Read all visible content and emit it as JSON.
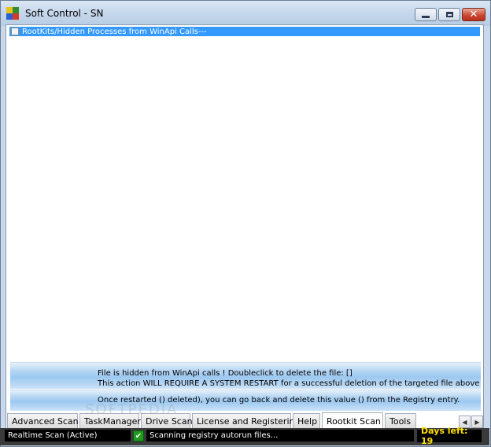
{
  "window": {
    "title": "Soft Control - SN"
  },
  "list": {
    "items": [
      {
        "label": "RootKits/Hidden Processes from WinApi Calls---",
        "selected": true,
        "checked": false
      }
    ]
  },
  "info": {
    "line1": "File is hidden from WinApi calls ! Doubleclick to delete the file: []",
    "line2": "This action WILL REQUIRE A SYSTEM RESTART for a successful deletion of the targeted file above",
    "line3": "Once restarted () deleted), you can go back and delete this value () from the Registry entry."
  },
  "tabs": [
    {
      "label": "Advanced Scan"
    },
    {
      "label": "TaskManager"
    },
    {
      "label": "Drive Scan"
    },
    {
      "label": "License and Registering"
    },
    {
      "label": "Help"
    },
    {
      "label": "Rootkit Scan",
      "active": true
    },
    {
      "label": "Tools"
    }
  ],
  "status": {
    "realtime": "Realtime Scan (Active)",
    "message": "Scanning registry autorun files...",
    "days_left": "Days left: 19"
  },
  "watermark": "SOFTPEDIA",
  "colors": {
    "selection": "#3399ff",
    "days_left_text": "#ffe000",
    "status_bg": "#000000"
  }
}
